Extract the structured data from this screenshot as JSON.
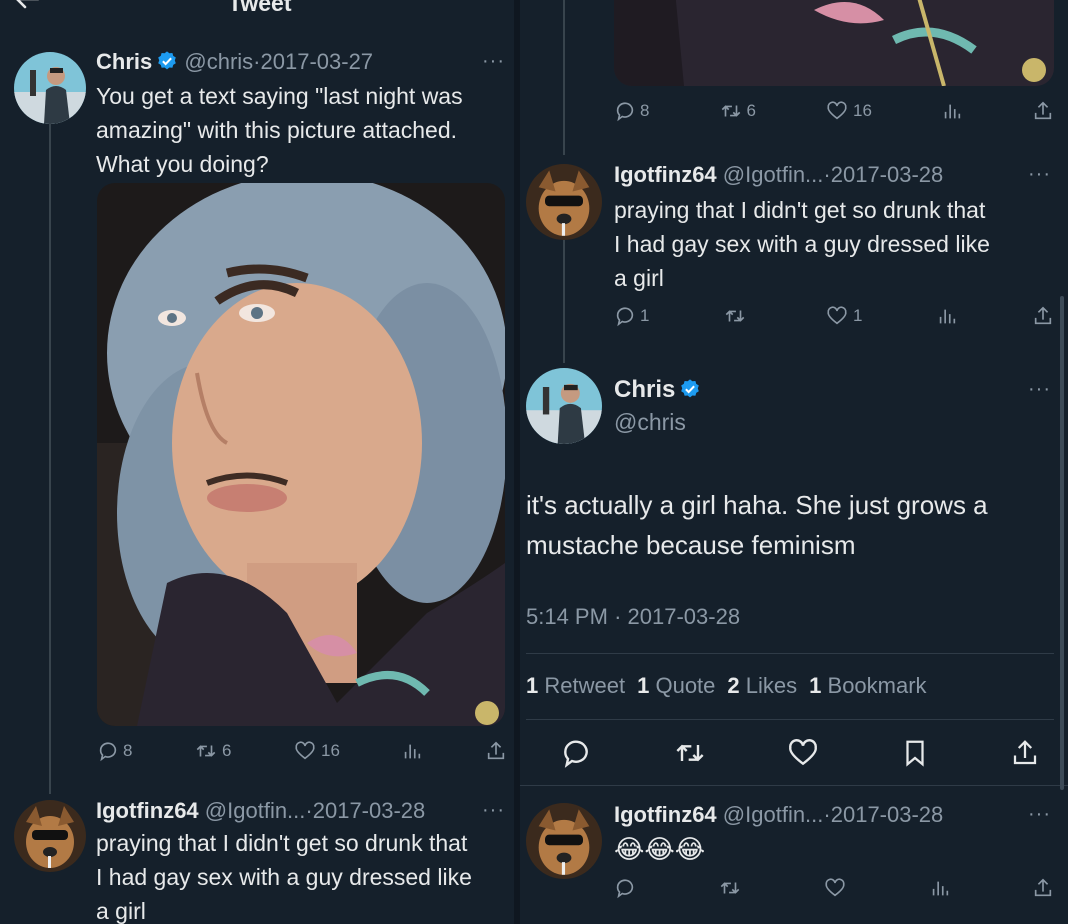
{
  "header": {
    "title": "Tweet",
    "back_icon": "arrow-left-icon"
  },
  "colors": {
    "bg": "#15202b",
    "text": "#e7e9ea",
    "muted": "#8b98a5",
    "accent": "#1d9bf0",
    "line": "#38444d"
  },
  "left": {
    "main_tweet": {
      "name": "Chris",
      "handle": "@chris",
      "sep": "·",
      "date": "2017-03-27",
      "more": "···",
      "text_lines": [
        "You get a text saying \"last night was",
        "amazing\" with this picture attached.",
        "What you doing?"
      ],
      "media_icon": "photo-image",
      "stats": {
        "replies": "8",
        "retweets": "6",
        "likes": "16"
      }
    },
    "reply": {
      "name": "Igotfinz64",
      "handle": "@Igotfin...",
      "sep": "·",
      "date": "2017-03-28",
      "more": "···",
      "text_lines": [
        "praying that I didn't get so drunk that",
        "I had gay sex with a guy dressed like",
        "a girl"
      ]
    }
  },
  "right": {
    "top_stats": {
      "replies": "8",
      "retweets": "6",
      "likes": "16"
    },
    "reply": {
      "name": "Igotfinz64",
      "handle": "@Igotfin...",
      "sep": "·",
      "date": "2017-03-28",
      "more": "···",
      "text_lines": [
        "praying that I didn't get so drunk that",
        "I had gay sex with a guy dressed like",
        "a girl"
      ],
      "stats": {
        "replies": "1",
        "retweets": "",
        "likes": "1"
      }
    },
    "focused": {
      "name": "Chris",
      "handle": "@chris",
      "more": "···",
      "text_lines": [
        "it's actually a girl haha. She just grows a",
        "mustache because feminism"
      ],
      "time": "5:14 PM",
      "sep": "·",
      "date": "2017-03-28",
      "counts": [
        {
          "num": "1",
          "label": "Retweet"
        },
        {
          "num": "1",
          "label": "Quote"
        },
        {
          "num": "2",
          "label": "Likes"
        },
        {
          "num": "1",
          "label": "Bookmark"
        }
      ]
    },
    "last_reply": {
      "name": "Igotfinz64",
      "handle": "@Igotfin...",
      "sep": "·",
      "date": "2017-03-28",
      "more": "···",
      "emojis": "😂😂😂"
    }
  }
}
